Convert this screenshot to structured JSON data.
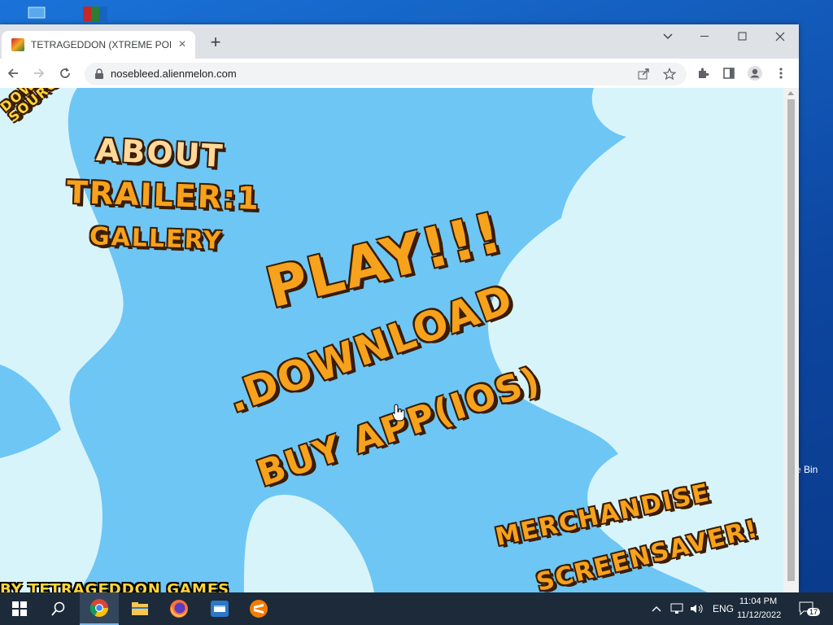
{
  "desktop": {
    "recycle_bin_label": "e Bin"
  },
  "browser": {
    "tab_title": "TETRAGEDDON (XTREME POLYG",
    "url": "nosebleed.alienmelon.com"
  },
  "page": {
    "download_source": "DOWNLOAD\nSOURCE",
    "about": "ABOUT",
    "trailer": "TRAILER:1",
    "gallery": "GALLERY",
    "play": "PLAY!!!",
    "download": ".DOWNLOAD",
    "buy_app": "BUY APP(IOS)",
    "merchandise": "MERCHANDISE",
    "screensaver": "SCREENSAVER!",
    "footer_credit": "BY TETRAGEDDON GAMES"
  },
  "taskbar": {
    "language": "ENG",
    "time": "11:04 PM",
    "date": "11/12/2022",
    "notification_count": "17",
    "apps": [
      "start",
      "search",
      "chrome",
      "file-explorer",
      "firefox",
      "app-store",
      "sublime"
    ]
  },
  "colors": {
    "sky": "#6ec6f5",
    "cloud": "#d8f4fb",
    "link_orange": "#f7a21c",
    "link_outline": "#3a1c00",
    "credit_yellow": "#ffd53a"
  }
}
